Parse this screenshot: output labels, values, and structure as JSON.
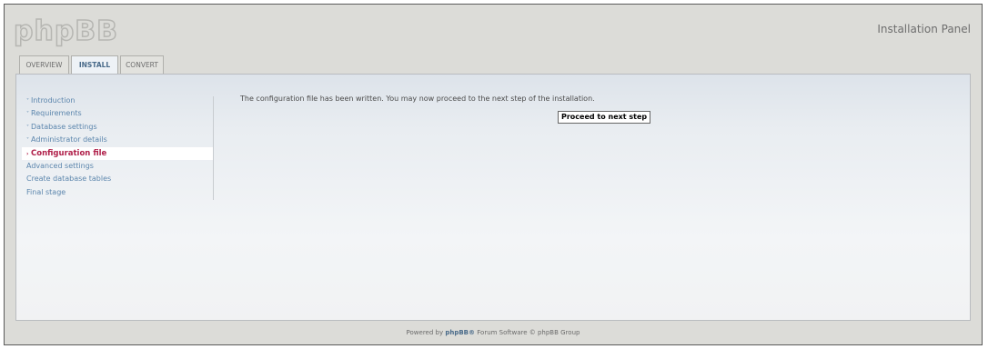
{
  "header": {
    "logo_text": "phpBB",
    "panel_title": "Installation Panel"
  },
  "tabs": [
    {
      "label": "OVERVIEW",
      "active": false
    },
    {
      "label": "INSTALL",
      "active": true
    },
    {
      "label": "CONVERT",
      "active": false
    }
  ],
  "menu": [
    {
      "label": "Introduction",
      "done": true
    },
    {
      "label": "Requirements",
      "done": true
    },
    {
      "label": "Database settings",
      "done": true
    },
    {
      "label": "Administrator details",
      "done": true
    },
    {
      "label": "Configuration file",
      "active": true
    },
    {
      "label": "Advanced settings"
    },
    {
      "label": "Create database tables"
    },
    {
      "label": "Final stage"
    }
  ],
  "main": {
    "message": "The configuration file has been written. You may now proceed to the next step of the installation.",
    "button_label": "Proceed to next step"
  },
  "footer": {
    "prefix": "Powered by ",
    "link": "phpBB®",
    "suffix": " Forum Software © phpBB Group"
  },
  "colors": {
    "accent": "#5c86ad",
    "active": "#b0204a",
    "background": "#dcdcd8"
  }
}
